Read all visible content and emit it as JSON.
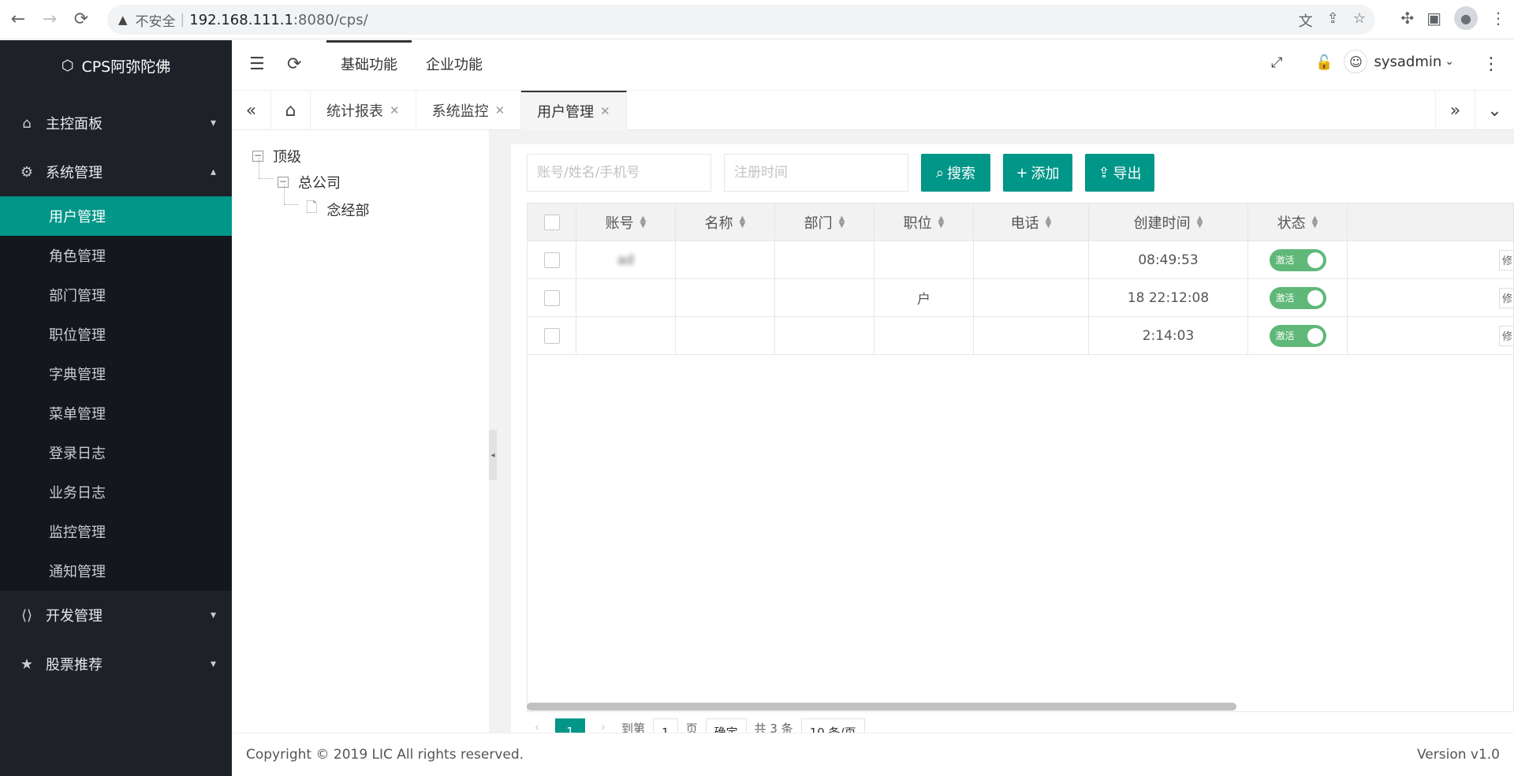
{
  "browser": {
    "insecure_label": "不安全",
    "url_host": "192.168.111.1",
    "url_rest": ":8080/cps/"
  },
  "sidebar": {
    "brand": "CPS阿弥陀佛",
    "groups": [
      {
        "label": "主控面板",
        "icon": "home-icon"
      },
      {
        "label": "系统管理",
        "icon": "gear-icon"
      },
      {
        "label": "开发管理",
        "icon": "code-icon"
      },
      {
        "label": "股票推荐",
        "icon": "star-icon"
      }
    ],
    "system_items": [
      "用户管理",
      "角色管理",
      "部门管理",
      "职位管理",
      "字典管理",
      "菜单管理",
      "登录日志",
      "业务日志",
      "监控管理",
      "通知管理"
    ],
    "active_color": "#009688"
  },
  "header": {
    "tabs": [
      "基础功能",
      "企业功能"
    ],
    "username": "sysadmin"
  },
  "page_tabs": [
    "统计报表",
    "系统监控",
    "用户管理"
  ],
  "tree": {
    "root": "顶级",
    "company": "总公司",
    "dept": "念经部"
  },
  "filters": {
    "account_placeholder": "账号/姓名/手机号",
    "date_placeholder": "注册时间"
  },
  "buttons": {
    "search": "搜索",
    "add": "添加",
    "export": "导出"
  },
  "table": {
    "columns": [
      "账号",
      "名称",
      "部门",
      "职位",
      "电话",
      "创建时间",
      "状态"
    ],
    "rows": [
      {
        "account": "ad",
        "name": "",
        "dept": "",
        "position": "",
        "phone": "",
        "created": "08:49:53",
        "status": "激活",
        "edit": "修"
      },
      {
        "account": "",
        "name": "",
        "dept": "",
        "position": "户",
        "phone": "",
        "created": "18 22:12:08",
        "status": "激活",
        "edit": "修"
      },
      {
        "account": "",
        "name": "",
        "dept": "",
        "position": "",
        "phone": "",
        "created": "2:14:03",
        "status": "激活",
        "edit": "修"
      }
    ]
  },
  "pager": {
    "current": "1",
    "goto_label": "到第",
    "goto_value": "1",
    "page_label": "页",
    "confirm": "确定",
    "total": "共 3 条",
    "page_size": "10 条/页"
  },
  "footer": {
    "copyright": "Copyright © 2019 LIC All rights reserved.",
    "version": "Version v1.0"
  }
}
